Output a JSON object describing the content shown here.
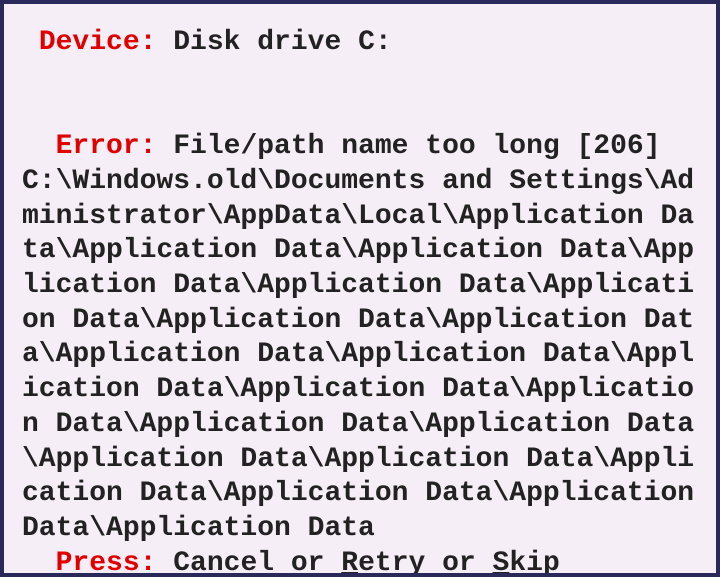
{
  "device_label": " Device: ",
  "device_value": "Disk drive C:",
  "error_label": "  Error: ",
  "error_value": "File/path name too long [206] C:\\Windows.old\\Documents and Settings\\Administrator\\AppData\\Local\\Application Data\\Application Data\\Application Data\\Application Data\\Application Data\\Application Data\\Application Data\\Application Data\\Application Data\\Application Data\\Application Data\\Application Data\\Application Data\\Application Data\\Application Data\\Application Data\\Application Data\\Application Data\\Application Data\\Application Data\\Application Data",
  "press_label": "  Press: ",
  "cancel_pre": "C",
  "cancel_rest": "ancel",
  "or1": " or ",
  "retry_pre": "R",
  "retry_rest": "etry",
  "or2": " or ",
  "skip_pre": "S",
  "skip_rest": "kip"
}
